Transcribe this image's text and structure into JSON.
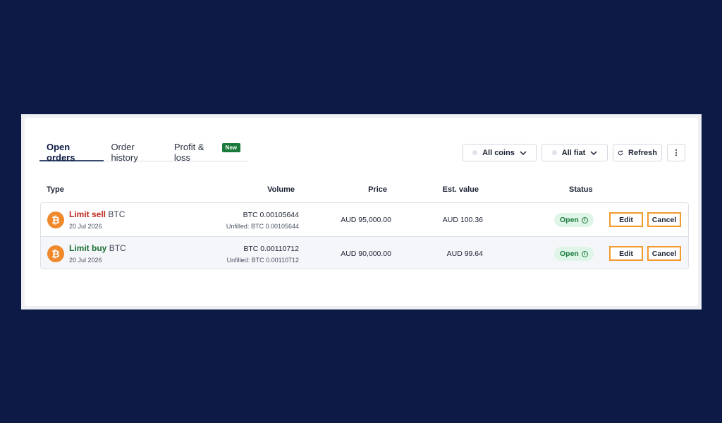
{
  "tabs": [
    {
      "label": "Open orders",
      "active": true
    },
    {
      "label": "Order history",
      "active": false
    },
    {
      "label": "Profit & loss",
      "active": false,
      "badge": "New"
    }
  ],
  "toolbar": {
    "coins_label": "All coins",
    "fiat_label": "All fiat",
    "refresh_label": "Refresh",
    "more_glyph": "⋮"
  },
  "columns": {
    "type": "Type",
    "volume": "Volume",
    "price": "Price",
    "est_value": "Est. value",
    "status": "Status"
  },
  "orders": [
    {
      "type": "Limit sell",
      "coin": "BTC",
      "date": "20 Jul 2026",
      "volume": "BTC 0.00105644",
      "unfilled": "Unfilled: BTC 0.00105644",
      "price": "AUD 95,000.00",
      "est_value": "AUD 100.36",
      "status": "Open",
      "edit_label": "Edit",
      "cancel_label": "Cancel"
    },
    {
      "type": "Limit buy",
      "coin": "BTC",
      "date": "20 Jul 2026",
      "volume": "BTC 0.00110712",
      "unfilled": "Unfilled: BTC 0.00110712",
      "price": "AUD 90,000.00",
      "est_value": "AUD 99.64",
      "status": "Open",
      "edit_label": "Edit",
      "cancel_label": "Cancel"
    }
  ],
  "colors": {
    "background": "#0d1a45",
    "sell": "#c0281e",
    "buy": "#1a6e34",
    "accent_outline": "#f29a2e",
    "status_green": "#1a7a3c",
    "btc_orange": "#f0892c"
  },
  "icons": {
    "btc": "bitcoin-icon",
    "refresh": "refresh-icon",
    "chevron": "chevron-down-icon",
    "info": "info-icon"
  }
}
